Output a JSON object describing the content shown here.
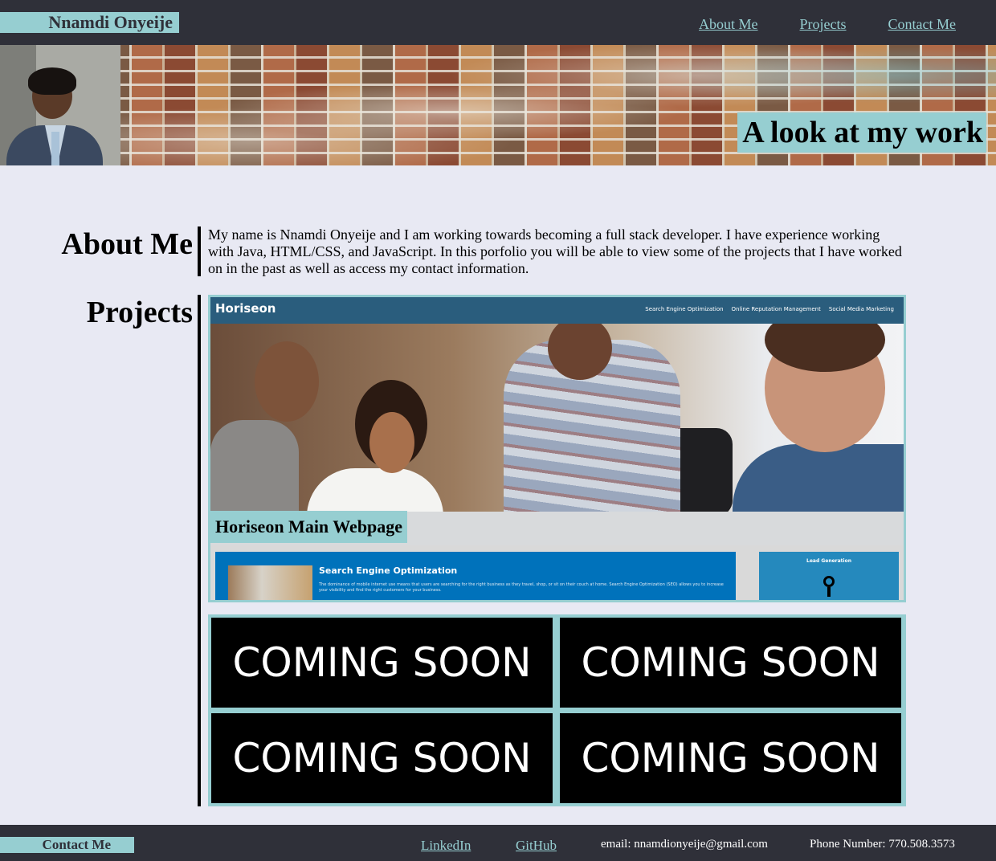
{
  "header": {
    "brand": "Nnamdi Onyeije",
    "nav": [
      "About Me",
      "Projects",
      "Contact Me"
    ]
  },
  "hero": {
    "tagline": "A look at my work"
  },
  "about": {
    "title": "About Me",
    "text": "My name is Nnamdi Onyeije and I am working towards becoming a full stack developer. I have experience working with Java, HTML/CSS, and JavaScript. In this porfolio you will be able to view some of the projects that I have worked on in the past as well as access my contact information."
  },
  "projects": {
    "title": "Projects",
    "featured": {
      "caption": "Horiseon Main Webpage",
      "site_logo": "Horiseon",
      "site_links": [
        "Search Engine Optimization",
        "Online Reputation Management",
        "Social Media Marketing"
      ],
      "seo_title": "Search Engine Optimization",
      "seo_text": "The dominance of mobile internet use means that users are searching for the right business as they travel, shop, or sit on their couch at home. Search Engine Optimization (SEO) allows you to increase your visibility and find the right customers for your business.",
      "lead_title": "Lead Generation"
    },
    "placeholders": [
      "COMING SOON",
      "COMING SOON",
      "COMING SOON",
      "COMING SOON"
    ]
  },
  "footer": {
    "title": "Contact Me",
    "linkedin": "LinkedIn",
    "github": "GitHub",
    "email": "email: nnamdionyeije@gmail.com",
    "phone": "Phone Number: 770.508.3573"
  },
  "colors": {
    "accent": "#96ced1",
    "dark": "#2f3039",
    "background": "#e8e9f3"
  }
}
